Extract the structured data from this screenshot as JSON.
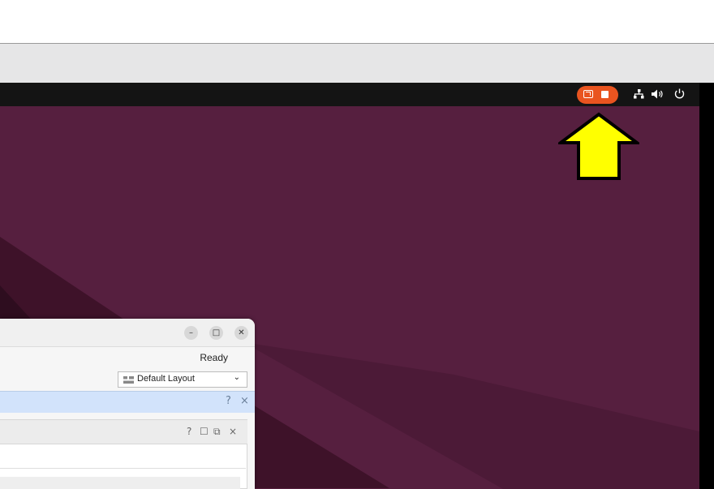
{
  "top_panel": {
    "recording_indicator": {
      "share_icon": "screen-share-icon",
      "stop_icon": "stop-icon",
      "color": "#e95420"
    },
    "tray": [
      "network-icon",
      "volume-icon",
      "power-icon"
    ]
  },
  "highlight": {
    "icon": "arrow-up-icon",
    "color": "#ffff00"
  },
  "window": {
    "controls": [
      "minimize-icon",
      "maximize-icon",
      "close-icon"
    ],
    "status": "Ready",
    "layout_select": {
      "value": "Default Layout"
    },
    "blue_bar_controls": [
      "?",
      "×"
    ],
    "sub_panel_controls": [
      "?",
      "☐",
      "⧉",
      "×"
    ]
  },
  "colors": {
    "wallpaper": "#561f3f",
    "panel": "#141414",
    "accent": "#e95420"
  }
}
